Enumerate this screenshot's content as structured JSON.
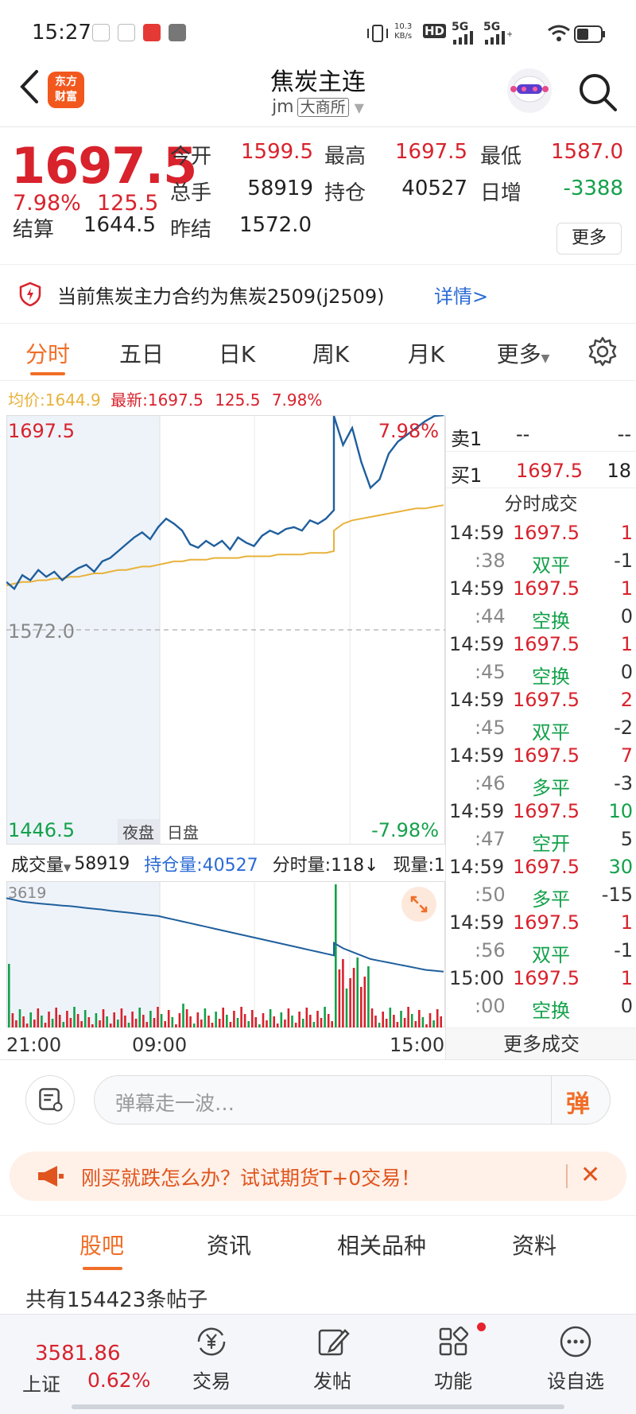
{
  "status_bar": {
    "time": "15:27",
    "net_speed_value": "10.3",
    "net_speed_unit": "KB/s",
    "hd_label": "HD",
    "signal1_label": "5G",
    "signal2_label": "5G"
  },
  "header": {
    "logo_line1": "东方",
    "logo_line2": "财富",
    "title": "焦炭主连",
    "code": "jm",
    "exchange": "大商所"
  },
  "quote": {
    "last_price": "1697.5",
    "change_pct": "7.98%",
    "change_abs": "125.5",
    "fields": [
      {
        "label": "今开",
        "value": "1599.5",
        "color": "#d8222c"
      },
      {
        "label": "最高",
        "value": "1697.5",
        "color": "#d8222c"
      },
      {
        "label": "最低",
        "value": "1587.0",
        "color": "#d8222c"
      },
      {
        "label": "总手",
        "value": "58919",
        "color": "#222222"
      },
      {
        "label": "持仓",
        "value": "40527",
        "color": "#222222"
      },
      {
        "label": "日增",
        "value": "-3388",
        "color": "#13a14a"
      },
      {
        "label": "结算",
        "value": "1644.5",
        "color": "#222222"
      },
      {
        "label": "昨结",
        "value": "1572.0",
        "color": "#222222"
      }
    ],
    "more_label": "更多"
  },
  "notice": {
    "text": "当前焦炭主力合约为焦炭2509(j2509)",
    "link": "详情>"
  },
  "chart_tabs": [
    "分时",
    "五日",
    "日K",
    "周K",
    "月K",
    "更多"
  ],
  "avg_line": {
    "avg_label": "均价:",
    "avg_value": "1644.9",
    "latest_label": "最新:",
    "latest_value": "1697.5",
    "latest_change": "125.5",
    "latest_pct": "7.98%"
  },
  "main_chart_labels": {
    "top_price": "1697.5",
    "top_pct": "7.98%",
    "mid_price": "1572.0",
    "bottom_price": "1446.5",
    "bottom_pct": "-7.98%",
    "night_label": "夜盘",
    "day_label": "日盘"
  },
  "volume_header": {
    "selector": "成交量",
    "volume_value": "58919",
    "open_interest": "持仓量:40527",
    "minute_volume": "分时量:118↓",
    "current_volume": "现量:1"
  },
  "volume_chart": {
    "max_label": "3619"
  },
  "time_axis": [
    "21:00",
    "09:00",
    "15:00"
  ],
  "chart_data": {
    "type": "line",
    "series": [
      {
        "values": [
          1600,
          1596,
          1604,
          1601,
          1607,
          1603,
          1606,
          1601,
          1605,
          1608,
          1610,
          1606,
          1612,
          1614,
          1618,
          1622,
          1626,
          1629,
          1625,
          1632,
          1637,
          1634,
          1630,
          1622,
          1620,
          1624,
          1621,
          1624,
          1619,
          1626,
          1623,
          1621,
          1627,
          1630,
          1628,
          1631,
          1632,
          1630,
          1636,
          1634,
          1637,
          1642,
          1697,
          1680,
          1690,
          1670,
          1655,
          1660,
          1675,
          1682,
          1686,
          1690,
          1694,
          1697,
          1697.5
        ]
      },
      {
        "values": [
          1598,
          1599,
          1600,
          1600,
          1601,
          1601,
          1602,
          1602,
          1603,
          1603,
          1604,
          1605,
          1605,
          1606,
          1607,
          1607,
          1608,
          1609,
          1609,
          1610,
          1611,
          1612,
          1612,
          1613,
          1613,
          1613,
          1614,
          1614,
          1614,
          1614,
          1615,
          1615,
          1615,
          1615,
          1616,
          1616,
          1616,
          1616,
          1617,
          1617,
          1617,
          1618,
          1630,
          1634,
          1636,
          1637,
          1638,
          1639,
          1640,
          1641,
          1642,
          1643,
          1643,
          1644,
          1644.9
        ]
      }
    ],
    "reference": 1572.0,
    "ylim": [
      1446.5,
      1697.5
    ],
    "volume_series": {
      "max": 3619,
      "open_interest_line": [
        3400,
        3390,
        3380,
        3375,
        3370,
        3366,
        3362,
        3358,
        3355,
        3350,
        3345,
        3340,
        3336,
        3330,
        3325,
        3320,
        3315,
        3310,
        3305,
        3300,
        3290,
        3280,
        3270,
        3260,
        3250,
        3240,
        3230,
        3220,
        3210,
        3200,
        3190,
        3180,
        3170,
        3160,
        3150,
        3140,
        3130,
        3120,
        3110,
        3100,
        3090,
        3080,
        3150,
        3120,
        3100,
        3080,
        3060,
        3050,
        3040,
        3030,
        3020,
        3010,
        3000,
        2995,
        2990
      ]
    }
  },
  "order_book": {
    "sell1": {
      "label": "卖1",
      "price": "--",
      "volume": "--"
    },
    "buy1": {
      "label": "买1",
      "price": "1697.5",
      "volume": "18"
    }
  },
  "ticks_title": "分时成交",
  "ticks": [
    {
      "time": "14:59",
      "price": "1697.5",
      "vol": "1",
      "vol_color": "#d8222c"
    },
    {
      "time": ":38",
      "type": "双平",
      "oi": "-1"
    },
    {
      "time": "14:59",
      "price": "1697.5",
      "vol": "1",
      "vol_color": "#d8222c"
    },
    {
      "time": ":44",
      "type": "空换",
      "oi": "0"
    },
    {
      "time": "14:59",
      "price": "1697.5",
      "vol": "1",
      "vol_color": "#d8222c"
    },
    {
      "time": ":45",
      "type": "空换",
      "oi": "0"
    },
    {
      "time": "14:59",
      "price": "1697.5",
      "vol": "2",
      "vol_color": "#d8222c"
    },
    {
      "time": ":45",
      "type": "双平",
      "oi": "-2"
    },
    {
      "time": "14:59",
      "price": "1697.5",
      "vol": "7",
      "vol_color": "#d8222c"
    },
    {
      "time": ":46",
      "type": "多平",
      "oi": "-3"
    },
    {
      "time": "14:59",
      "price": "1697.5",
      "vol": "10",
      "vol_color": "#13a14a"
    },
    {
      "time": ":47",
      "type": "空开",
      "oi": "5"
    },
    {
      "time": "14:59",
      "price": "1697.5",
      "vol": "30",
      "vol_color": "#13a14a"
    },
    {
      "time": ":50",
      "type": "多平",
      "oi": "-15"
    },
    {
      "time": "14:59",
      "price": "1697.5",
      "vol": "1",
      "vol_color": "#d8222c"
    },
    {
      "time": ":56",
      "type": "双平",
      "oi": "-1"
    },
    {
      "time": "15:00",
      "price": "1697.5",
      "vol": "1",
      "vol_color": "#d8222c"
    },
    {
      "time": ":00",
      "type": "空换",
      "oi": "0"
    }
  ],
  "more_trades": "更多成交",
  "danmu": {
    "placeholder": "弹幕走一波…",
    "send_label": "弹"
  },
  "promo": {
    "text": "刚买就跌怎么办？试试期货T+0交易！",
    "close": "✕"
  },
  "section_tabs": [
    "股吧",
    "资讯",
    "相关品种",
    "资料"
  ],
  "post_count": "共有154423条帖子",
  "bottom_nav": {
    "index_value": "3581.86",
    "index_name": "上证",
    "index_change": "0.62%",
    "items": [
      {
        "label": "交易"
      },
      {
        "label": "发帖"
      },
      {
        "label": "功能"
      },
      {
        "label": "设自选"
      }
    ]
  },
  "colors": {
    "up": "#d8222c",
    "down": "#13a14a",
    "price_line": "#1f5f9e",
    "avg_line": "#e8b23b",
    "accent": "#f06e27"
  }
}
